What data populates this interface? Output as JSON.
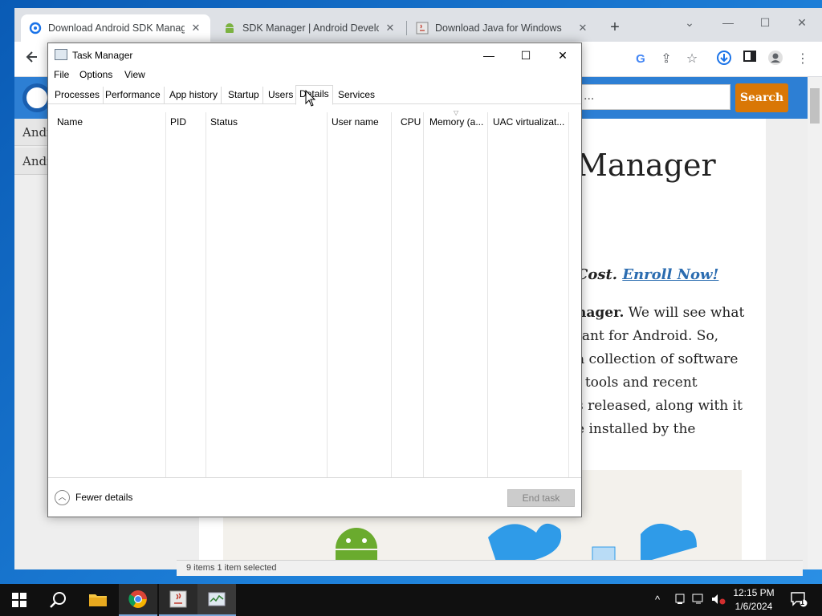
{
  "browser": {
    "tabs": [
      {
        "title": "Download Android SDK Manage",
        "active": true,
        "favicon": "hub-logo-icon"
      },
      {
        "title": "SDK Manager | Android Develop",
        "active": false,
        "favicon": "android-icon"
      },
      {
        "title": "Download Java for Windows",
        "active": false,
        "favicon": "java-icon"
      }
    ],
    "new_tab_symbol": "+",
    "window_controls": {
      "chevron": "⌄",
      "minimize": "—",
      "maximize": "☐",
      "close": "✕"
    }
  },
  "website": {
    "search_placeholder": "...",
    "search_button": "Search",
    "side_menu": [
      "Andr",
      "Andr"
    ],
    "title_fragment": "Manager",
    "promo_text": "Cost.",
    "promo_link": "Enroll Now!",
    "body_lines": [
      {
        "bold": "nager.",
        "text": " We will see what"
      },
      {
        "bold": "",
        "text": "tant for Android. So,"
      },
      {
        "bold": "",
        "text": "a collection of software"
      },
      {
        "bold": "",
        "text": "l tools and recent"
      },
      {
        "bold": "",
        "text": "s released, along with it"
      },
      {
        "bold": "",
        "text": "e installed by the"
      }
    ],
    "status_remnant": "9 items    1 item selected"
  },
  "task_manager": {
    "title": "Task Manager",
    "menu": [
      "File",
      "Options",
      "View"
    ],
    "tabs": [
      "Processes",
      "Performance",
      "App history",
      "Startup",
      "Users",
      "Details",
      "Services"
    ],
    "active_tab": "Details",
    "columns": [
      "Name",
      "PID",
      "Status",
      "User name",
      "CPU",
      "Memory (a...",
      "UAC virtualizat..."
    ],
    "fewer_details": "Fewer details",
    "end_task": "End task",
    "window_controls": {
      "minimize": "—",
      "maximize": "☐",
      "close": "✕"
    }
  },
  "taskbar": {
    "apps": [
      "start-icon",
      "search-icon",
      "file-explorer-icon",
      "chrome-icon",
      "java-icon",
      "task-manager-icon"
    ],
    "tray_chevron": "^",
    "time": "12:15 PM",
    "date": "1/6/2024",
    "notification_count": "1"
  },
  "colors": {
    "site_header": "#2d7fd4",
    "search_button": "#d97706",
    "taskbar": "#101010",
    "accent": "#7aa6d8"
  }
}
